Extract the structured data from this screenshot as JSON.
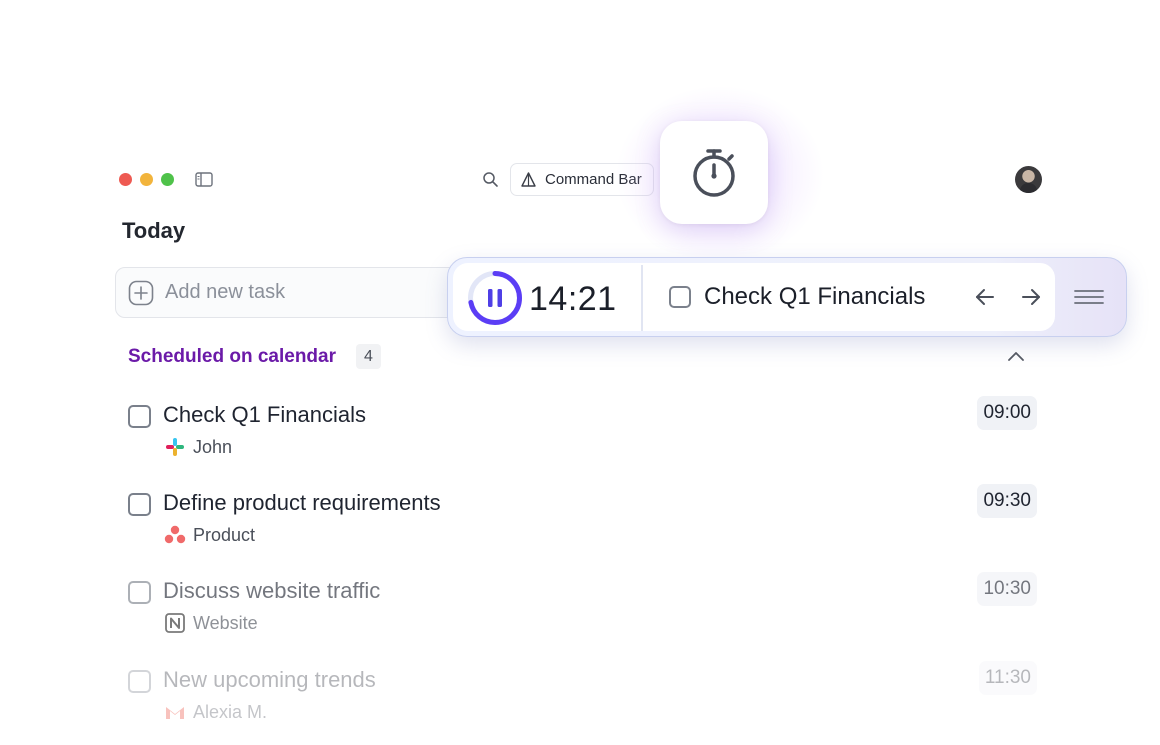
{
  "toolbar": {
    "command_bar_label": "Command Bar"
  },
  "page": {
    "title": "Today",
    "add_task_placeholder": "Add new task"
  },
  "timer": {
    "time": "14:21",
    "progress": 0.72,
    "current_task": "Check Q1 Financials",
    "ring_color": "#5b3df5"
  },
  "section": {
    "title": "Scheduled on calendar",
    "count": "4",
    "accent": "#6b1aa8"
  },
  "tasks": [
    {
      "title": "Check Q1 Financials",
      "source_icon": "slack-icon",
      "source": "John",
      "time": "09:00"
    },
    {
      "title": "Define product requirements",
      "source_icon": "asana-icon",
      "source": "Product",
      "time": "09:30"
    },
    {
      "title": "Discuss website traffic",
      "source_icon": "notion-icon",
      "source": "Website",
      "time": "10:30"
    },
    {
      "title": "New upcoming trends",
      "source_icon": "gmail-icon",
      "source": "Alexia M.",
      "time": "11:30"
    }
  ]
}
